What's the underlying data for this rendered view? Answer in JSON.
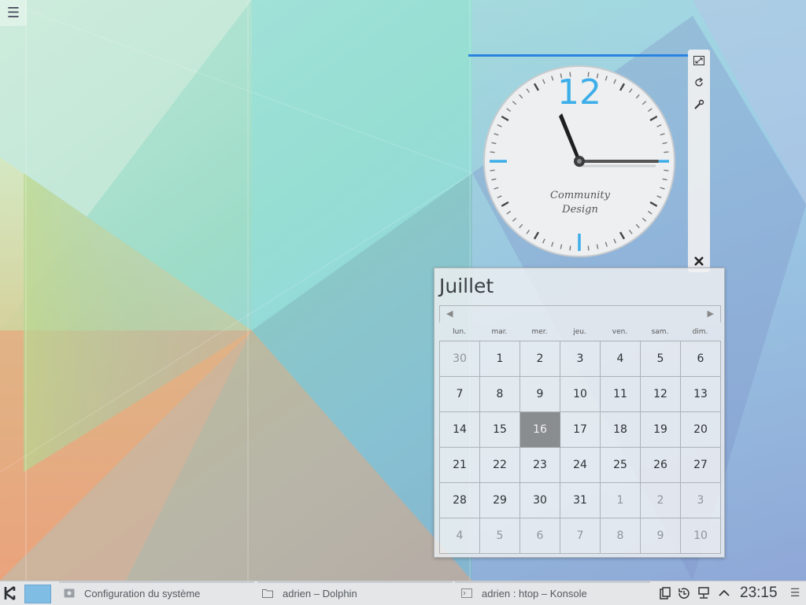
{
  "desktop": {
    "menu_icon": "hamburger-icon"
  },
  "clock_applet": {
    "numeral": "12",
    "brand_line1": "Community",
    "brand_line2": "Design",
    "time_shown": "11:15",
    "handle_icons": [
      "resize-icon",
      "rotate-icon",
      "wrench-icon",
      "close-icon"
    ]
  },
  "calendar": {
    "month": "Juillet",
    "weekdays": [
      "lun.",
      "mar.",
      "mer.",
      "jeu.",
      "ven.",
      "sam.",
      "dim."
    ],
    "days": [
      [
        "30",
        "1",
        "2",
        "3",
        "4",
        "5",
        "6"
      ],
      [
        "7",
        "8",
        "9",
        "10",
        "11",
        "12",
        "13"
      ],
      [
        "14",
        "15",
        "16",
        "17",
        "18",
        "19",
        "20"
      ],
      [
        "21",
        "22",
        "23",
        "24",
        "25",
        "26",
        "27"
      ],
      [
        "28",
        "29",
        "30",
        "31",
        "1",
        "2",
        "3"
      ],
      [
        "4",
        "5",
        "6",
        "7",
        "8",
        "9",
        "10"
      ]
    ],
    "today": "16"
  },
  "taskbar": {
    "tasks": [
      {
        "label": "Configuration du système",
        "icon": "settings-icon"
      },
      {
        "label": "adrien – Dolphin",
        "icon": "folder-icon"
      },
      {
        "label": "adrien : htop – Konsole",
        "icon": "terminal-icon"
      }
    ],
    "tray_icons": [
      "clipboard-icon",
      "updates-icon",
      "network-icon",
      "expand-icon"
    ],
    "time": "23:15"
  },
  "colors": {
    "accent": "#3daee9",
    "selection_bar": "#2a83e0",
    "today_bg": "#8a8d90"
  }
}
